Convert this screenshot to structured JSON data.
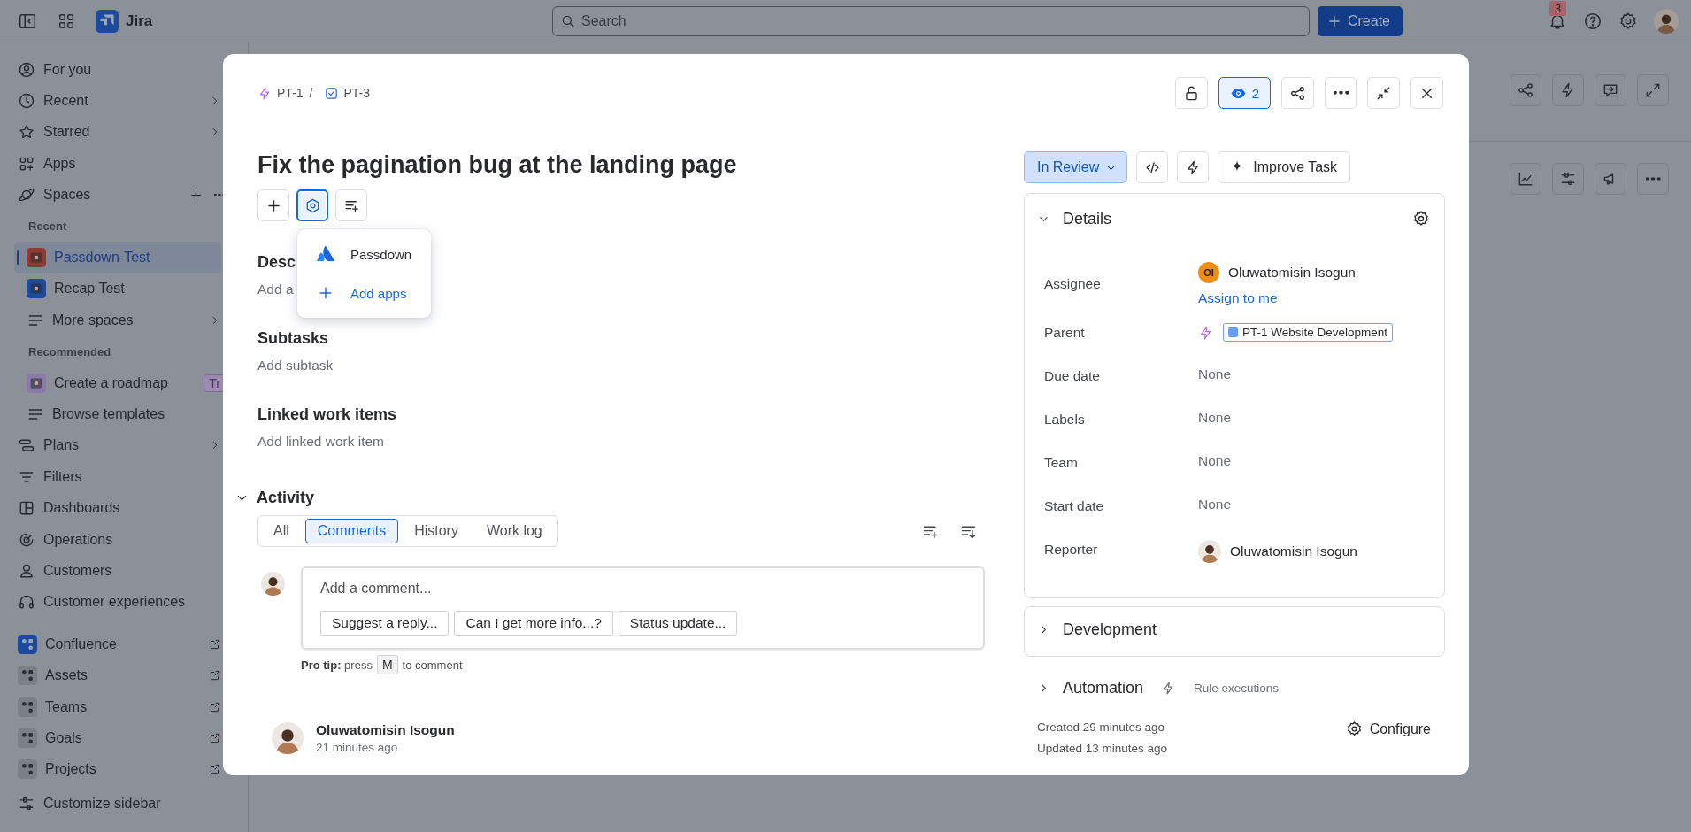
{
  "topbar": {
    "product": "Jira",
    "search_placeholder": "Search",
    "create_label": "Create",
    "notification_count": "3"
  },
  "sidebar": {
    "items": [
      {
        "kind": "link",
        "label": "For you",
        "selected": false
      },
      {
        "kind": "menu",
        "label": "Recent",
        "selected": false
      },
      {
        "kind": "menu",
        "label": "Starred",
        "selected": false
      },
      {
        "kind": "link",
        "label": "Apps",
        "selected": false
      },
      {
        "kind": "spaces",
        "label": "Spaces",
        "selected": false,
        "children": [
          {
            "kind": "header",
            "label": "Recent"
          },
          {
            "kind": "space",
            "label": "Passdown-Test",
            "selected": true
          },
          {
            "kind": "space",
            "label": "Recap Test",
            "selected": false
          },
          {
            "kind": "menu",
            "label": "More spaces",
            "selected": false
          },
          {
            "kind": "header",
            "label": "Recommended"
          },
          {
            "kind": "space",
            "label": "Create a roadmap",
            "selected": false,
            "badge": "Tr"
          },
          {
            "kind": "link",
            "label": "Browse templates",
            "selected": false
          }
        ]
      },
      {
        "kind": "menu",
        "label": "Plans",
        "selected": false
      },
      {
        "kind": "link",
        "label": "Filters",
        "selected": false
      },
      {
        "kind": "link",
        "label": "Dashboards",
        "selected": false
      },
      {
        "kind": "link",
        "label": "Operations",
        "selected": false
      },
      {
        "kind": "link",
        "label": "Customers",
        "selected": false
      },
      {
        "kind": "link",
        "label": "Customer experiences",
        "selected": false
      },
      {
        "kind": "app",
        "label": "Confluence",
        "selected": false
      },
      {
        "kind": "app",
        "label": "Assets",
        "selected": false
      },
      {
        "kind": "app",
        "label": "Teams",
        "selected": false
      },
      {
        "kind": "app",
        "label": "Goals",
        "selected": false
      },
      {
        "kind": "app",
        "label": "Projects",
        "selected": false
      },
      {
        "kind": "footer",
        "label": "Customize sidebar",
        "selected": false
      }
    ]
  },
  "issue": {
    "breadcrumb": [
      {
        "kind": "epic",
        "key": "PT-1"
      },
      {
        "kind": "task",
        "key": "PT-3"
      }
    ],
    "breadcrumb_separator": "/",
    "watch": {
      "count": "2",
      "selected": true
    },
    "title": "Fix the pagination bug at the landing page",
    "title_actions": [
      {
        "selected": false
      },
      {
        "selected": true
      },
      {
        "selected": false
      }
    ],
    "apps_menu": [
      {
        "kind": "app",
        "label": "Passdown"
      },
      {
        "kind": "add",
        "label": "Add apps"
      }
    ],
    "sections": [
      {
        "heading": "Desc",
        "placeholder": "Add a"
      },
      {
        "heading": "Subtasks",
        "placeholder": "Add subtask"
      },
      {
        "heading": "Linked work items",
        "placeholder": "Add linked work item"
      }
    ],
    "activity": {
      "heading": "Activity",
      "expanded": true,
      "tabs": [
        {
          "label": "All",
          "selected": false
        },
        {
          "label": "Comments",
          "selected": true
        },
        {
          "label": "History",
          "selected": false
        },
        {
          "label": "Work log",
          "selected": false
        }
      ],
      "comment_placeholder": "Add a comment...",
      "suggestions": [
        "Suggest a reply...",
        "Can I get more info...?",
        "Status update..."
      ],
      "pro_tip": {
        "before": "**Pro tip:** press",
        "key": "M",
        "after": "to comment"
      },
      "comments": [
        {
          "author": "Oluwatomisin Isogun",
          "time": "21 minutes ago"
        }
      ]
    },
    "status": "In Review",
    "improve_label": "Improve Task",
    "details": {
      "heading": "Details",
      "expanded": true,
      "fields": [
        {
          "kind": "user",
          "label": "Assignee",
          "value": "Oluwatomisin Isogun",
          "initials": "OI",
          "action": "Assign to me"
        },
        {
          "kind": "parent",
          "label": "Parent",
          "value": "PT-1 Website Development"
        },
        {
          "kind": "empty",
          "label": "Due date",
          "value": "None"
        },
        {
          "kind": "empty",
          "label": "Labels",
          "value": "None"
        },
        {
          "kind": "empty",
          "label": "Team",
          "value": "None"
        },
        {
          "kind": "empty",
          "label": "Start date",
          "value": "None"
        },
        {
          "kind": "user",
          "label": "Reporter",
          "value": "Oluwatomisin Isogun"
        }
      ]
    },
    "development": {
      "heading": "Development",
      "expanded": false
    },
    "automation": {
      "heading": "Automation",
      "expanded": false,
      "link": "Rule executions"
    },
    "created": "Created 29 minutes ago",
    "updated": "Updated 13 minutes ago",
    "configure": "Configure"
  }
}
